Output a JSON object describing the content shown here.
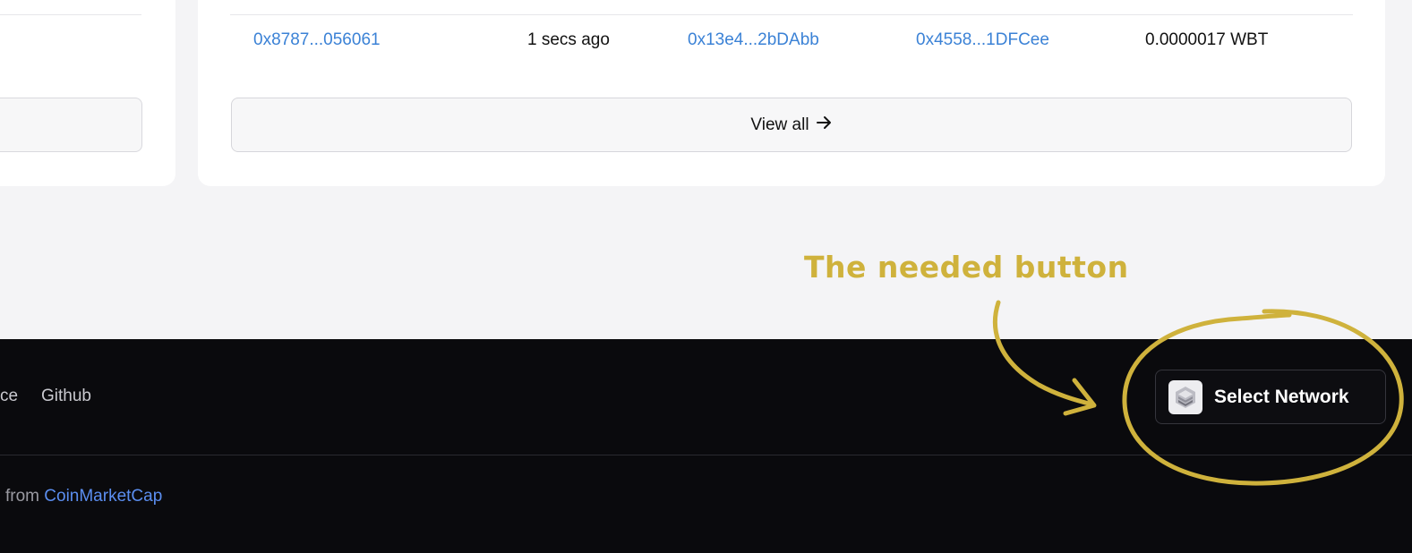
{
  "transaction_row": {
    "hash": "0x8787...056061",
    "age": "1 secs ago",
    "from": "0x13e4...2bDAbb",
    "to": "0x4558...1DFCee",
    "value": "0.0000017 WBT"
  },
  "view_all": {
    "label": "View all",
    "icon": "arrow-right-icon"
  },
  "annotation": {
    "text": "The needed button",
    "color": "#cfb23c"
  },
  "footer": {
    "links": [
      "ce",
      "Github"
    ],
    "credit_prefix": "from",
    "credit_link": "CoinMarketCap",
    "network_button": {
      "label": "Select Network",
      "icon": "network-layers-icon"
    }
  },
  "colors": {
    "link": "#3b82d6",
    "footer_bg": "#0a0a0d",
    "page_bg": "#f4f4f6"
  }
}
